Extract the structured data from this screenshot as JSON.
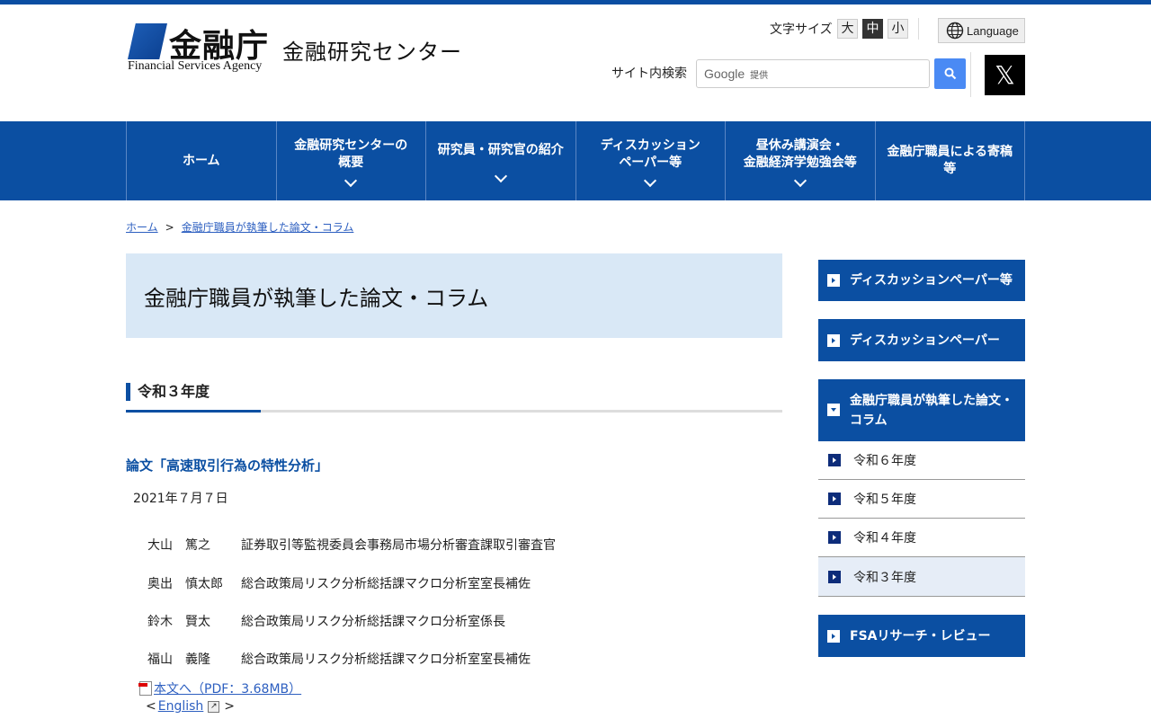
{
  "header": {
    "logo_kanji": "金融庁",
    "logo_en": "Financial Services Agency",
    "site_name": "金融研究センター",
    "font_size_label": "文字サイズ",
    "font_sizes": [
      "大",
      "中",
      "小"
    ],
    "font_size_selected": "中",
    "language": "Language",
    "search_label": "サイト内検索",
    "search_placeholder": "Google",
    "search_provided": "提供",
    "x_icon": "𝕏"
  },
  "nav": [
    {
      "label": "ホーム"
    },
    {
      "label": "金融研究センターの概要"
    },
    {
      "label": "研究員・研究官の紹介"
    },
    {
      "label": "ディスカッションペーパー等"
    },
    {
      "label": "昼休み講演会・金融経済学勉強会等"
    },
    {
      "label": "金融庁職員による寄稿等"
    }
  ],
  "nav_lines": {
    "n1a": "金融研究センターの",
    "n1b": "概要",
    "n3a": "ディスカッション",
    "n3b": "ペーパー等",
    "n4a": "昼休み講演会・",
    "n4b": "金融経済学勉強会等",
    "n5a": "金融庁職員による寄稿",
    "n5b": "等"
  },
  "breadcrumb": {
    "home": "ホーム",
    "sep": ">",
    "current": "金融庁職員が執筆した論文・コラム"
  },
  "page_title": "金融庁職員が執筆した論文・コラム",
  "section": "令和３年度",
  "article": {
    "title": "論文「高速取引行為の特性分析」",
    "date": "2021年７月７日",
    "authors": [
      {
        "name": "大山　篤之",
        "role": "証券取引等監視委員会事務局市場分析審査課取引審査官"
      },
      {
        "name": "奥出　慎太郎",
        "role": "総合政策局リスク分析総括課マクロ分析室室長補佐"
      },
      {
        "name": "鈴木　賢太",
        "role": "総合政策局リスク分析総括課マクロ分析室係長"
      },
      {
        "name": "福山　義隆",
        "role": "総合政策局リスク分析総括課マクロ分析室室長補佐"
      }
    ],
    "pdf_link": "本文へ（PDF：3.68MB）",
    "english_open": "<",
    "english": "English",
    "english_close": ">"
  },
  "sidebar": {
    "b1": "ディスカッションペーパー等",
    "b2": "ディスカッションペーパー",
    "b3a": "金融庁職員が執筆した論文・",
    "b3b": "コラム",
    "subs": [
      "令和６年度",
      "令和５年度",
      "令和４年度",
      "令和３年度"
    ],
    "b4": "FSAリサーチ・レビュー"
  }
}
